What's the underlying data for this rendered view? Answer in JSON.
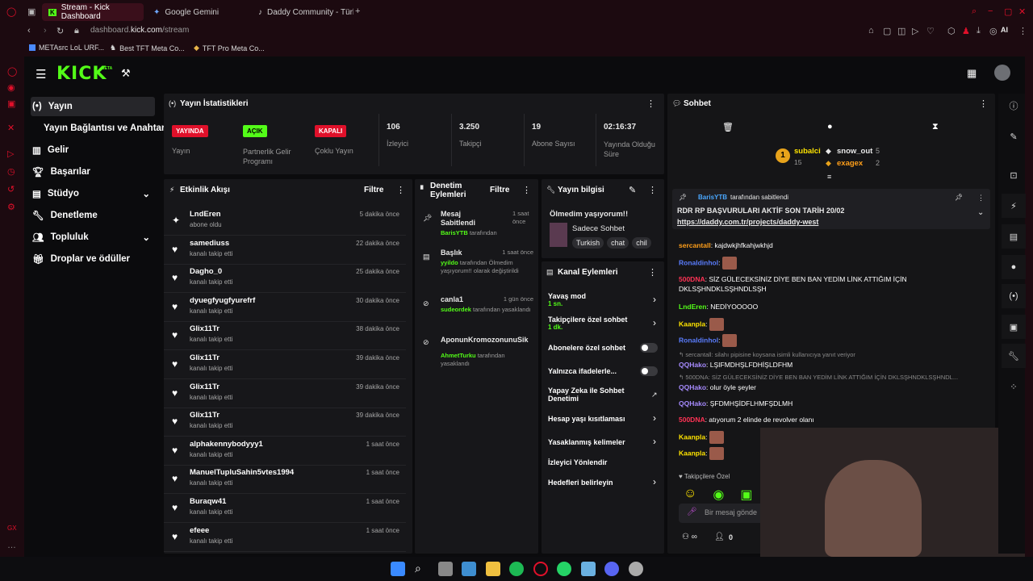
{
  "browser": {
    "tabs": [
      {
        "label": "Stream - Kick Dashboard"
      },
      {
        "label": "Google Gemini"
      },
      {
        "label": "Daddy Community - Türkiy..."
      }
    ],
    "url_host": "dashboard.",
    "url_domain": "kick.com",
    "url_path": "/stream",
    "ai_label": "AI",
    "bookmarks": [
      {
        "label": "METAsrc LoL URF..."
      },
      {
        "label": "Best TFT Meta Co..."
      },
      {
        "label": "TFT Pro Meta Co..."
      }
    ]
  },
  "nav": {
    "logo": "KICK",
    "items": [
      {
        "label": "Yayın"
      },
      {
        "label": "Yayın Bağlantısı ve Anahtarı"
      },
      {
        "label": "Gelir"
      },
      {
        "label": "Başarılar"
      },
      {
        "label": "Stüdyo"
      },
      {
        "label": "Denetleme"
      },
      {
        "label": "Topluluk"
      },
      {
        "label": "Droplar ve ödüller"
      }
    ]
  },
  "stats": {
    "title": "Yayın İstatistikleri",
    "cards": [
      {
        "badge": "YAYINDA",
        "label": "Yayın",
        "color": "#e0102a"
      },
      {
        "badge": "AÇIK",
        "label": "Partnerlik Gelir Programı",
        "color": "#53fc18"
      },
      {
        "badge": "KAPALI",
        "label": "Çoklu Yayın",
        "color": "#e0102a"
      },
      {
        "value": "106",
        "label": "İzleyici"
      },
      {
        "value": "3.250",
        "label": "Takipçi"
      },
      {
        "value": "19",
        "label": "Abone Sayısı"
      },
      {
        "value": "02:16:37",
        "label": "Yayında Olduğu Süre"
      }
    ]
  },
  "activity": {
    "title": "Etkinlik Akışı",
    "filter": "Filtre",
    "items": [
      {
        "name": "LndEren",
        "sub": "abone oldu",
        "time": "5 dakika önce"
      },
      {
        "name": "samediuss",
        "sub": "kanalı takip etti",
        "time": "22 dakika önce"
      },
      {
        "name": "Dagho_0",
        "sub": "kanalı takip etti",
        "time": "25 dakika önce"
      },
      {
        "name": "dyuegfyugfyurefrf",
        "sub": "kanalı takip etti",
        "time": "30 dakika önce"
      },
      {
        "name": "Glix11Tr",
        "sub": "kanalı takip etti",
        "time": "38 dakika önce"
      },
      {
        "name": "Glix11Tr",
        "sub": "kanalı takip etti",
        "time": "39 dakika önce"
      },
      {
        "name": "Glix11Tr",
        "sub": "kanalı takip etti",
        "time": "39 dakika önce"
      },
      {
        "name": "Glix11Tr",
        "sub": "kanalı takip etti",
        "time": "39 dakika önce"
      },
      {
        "name": "alphakennybodyyy1",
        "sub": "kanalı takip etti",
        "time": "1 saat önce"
      },
      {
        "name": "ManuelTupluSahin5vtes1994",
        "sub": "kanalı takip etti",
        "time": "1 saat önce"
      },
      {
        "name": "Buraqw41",
        "sub": "kanalı takip etti",
        "time": "1 saat önce"
      },
      {
        "name": "efeee",
        "sub": "kanalı takip etti",
        "time": "1 saat önce"
      }
    ]
  },
  "moderation": {
    "title": "Denetim Eylemleri",
    "filter": "Filtre",
    "items": [
      {
        "title": "Mesaj Sabitlendi",
        "time": "1 saat önce",
        "user": "BarisYTB",
        "rest": " tarafından"
      },
      {
        "title": "Başlık",
        "time": "1 saat önce",
        "user": "yyildo",
        "rest": " tarafından Ölmedim yaşıyorum!! olarak değiştirildi"
      },
      {
        "title": "canla1",
        "time": "1 gün önce",
        "user": "sudeordek",
        "rest": " tarafından yasaklandı"
      },
      {
        "title": "AponunKromozonunuSik",
        "time": "",
        "user": "AhmetTurku",
        "rest": " tarafından yasaklandı"
      }
    ]
  },
  "streaminfo": {
    "title": "Yayın bilgisi",
    "stream_title": "Ölmedim yaşıyorum!!",
    "category": "Sadece Sohbet",
    "tags": [
      "Turkish",
      "chat",
      "chil"
    ]
  },
  "channel_actions": {
    "title": "Kanal Eylemleri",
    "items": [
      {
        "label": "Yavaş mod",
        "sub": "1 sn."
      },
      {
        "label": "Takipçilere özel sohbet",
        "sub": "1 dk."
      },
      {
        "label": "Abonelere özel sohbet",
        "sub": ""
      },
      {
        "label": "Yalnızca ifadelerle...",
        "sub": ""
      },
      {
        "label": "Yapay Zeka ile Sohbet Denetimi",
        "sub": ""
      },
      {
        "label": "Hesap yaşı kısıtlaması",
        "sub": ""
      },
      {
        "label": "Yasaklanmış kelimeler",
        "sub": ""
      },
      {
        "label": "İzleyici Yönlendir",
        "sub": ""
      },
      {
        "label": "Hedefleri belirleyin",
        "sub": ""
      }
    ]
  },
  "chat": {
    "title": "Sohbet",
    "leaderboard": [
      {
        "name": "subalci",
        "count": "15",
        "rank": "1"
      },
      {
        "name": "snow_out",
        "count": "5"
      },
      {
        "name": "exagex",
        "count": "2"
      }
    ],
    "pinned": {
      "by": "BarisYTB",
      "by_rest": " tarafından sabitlendi",
      "text": "RDR RP BAŞVURULARI AKTİF SON TARİH 20/02",
      "link": "https://daddy.com.tr/projects/daddy-west"
    },
    "messages": [
      {
        "user": "sercantall",
        "color": "#ff9f1a",
        "text": "kajdwkjhfkahjwkhjd"
      },
      {
        "user": "Ronaldinhol",
        "color": "#5a7dff",
        "text": ""
      },
      {
        "user": "500DNA",
        "color": "#ff3355",
        "text": "SİZ GÜLECEKSİNİZ DİYE BEN BAN YEDİM LİNK ATTIĞIM İÇİN DKLSŞHNDKLSŞHNDLSŞH"
      },
      {
        "user": "LndEren",
        "color": "#53fc18",
        "text": "NEDİYOOOOO"
      },
      {
        "user": "Kaanpla",
        "color": "#ffe400",
        "text": ""
      },
      {
        "user": "Ronaldinhol",
        "color": "#5a7dff",
        "text": ""
      },
      {
        "reply": "sercantall: silahı pipisine koysana isimli kullanıcıya yanıt veriyor"
      },
      {
        "user": "QQHako",
        "color": "#a78bff",
        "text": "LŞIFMDHŞLFDHİŞLDFHM"
      },
      {
        "reply": "500DNA: SİZ GÜLECEKSİNİZ DİYE BEN BAN YEDİM LİNK ATTIĞIM İÇİN DKLSŞHNDKLSŞHNDL..."
      },
      {
        "user": "QQHako",
        "color": "#a78bff",
        "text": "olur öyle şeyler"
      },
      {
        "user": "QQHako",
        "color": "#a78bff",
        "text": "ŞFDMHŞİDFLHMFŞDLMH"
      },
      {
        "user": "500DNA",
        "color": "#ff3355",
        "text": "atıyorum 2 elinde de revolver olanı"
      },
      {
        "user": "Kaanpla",
        "color": "#ffe400",
        "text": ""
      },
      {
        "user": "Kaanpla",
        "color": "#ffe400",
        "text": ""
      }
    ],
    "followers_only": "Takipçilere Özel",
    "input_placeholder": "Bir mesaj gönde",
    "count": "0"
  }
}
